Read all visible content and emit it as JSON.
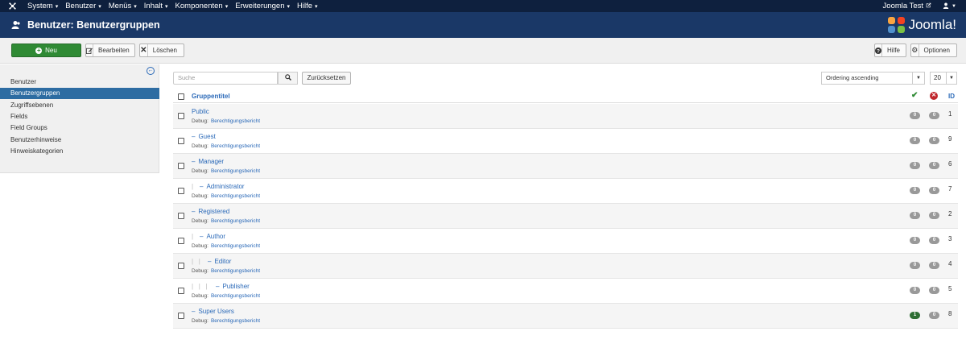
{
  "topbar": {
    "menu": [
      {
        "label": "System"
      },
      {
        "label": "Benutzer"
      },
      {
        "label": "Menüs"
      },
      {
        "label": "Inhalt"
      },
      {
        "label": "Komponenten"
      },
      {
        "label": "Erweiterungen"
      },
      {
        "label": "Hilfe"
      }
    ],
    "site_name": "Joomla Test",
    "external_icon": "external-link-icon",
    "user_icon": "user-icon"
  },
  "header": {
    "title": "Benutzer: Benutzergruppen",
    "brand": "Joomla!",
    "icon": "users-icon"
  },
  "toolbar": {
    "new_label": "Neu",
    "edit_label": "Bearbeiten",
    "delete_label": "Löschen",
    "help_label": "Hilfe",
    "options_label": "Optionen"
  },
  "sidebar": {
    "items": [
      {
        "label": "Benutzer"
      },
      {
        "label": "Benutzergruppen"
      },
      {
        "label": "Zugriffsebenen"
      },
      {
        "label": "Fields"
      },
      {
        "label": "Field Groups"
      },
      {
        "label": "Benutzerhinweise"
      },
      {
        "label": "Hinweiskategorien"
      }
    ],
    "active_index": 1
  },
  "filters": {
    "search_placeholder": "Suche",
    "reset_label": "Zurücksetzen",
    "ordering_value": "Ordering ascending",
    "limit_value": "20"
  },
  "table": {
    "column_title": "Gruppentitel",
    "column_id": "ID",
    "debug_prefix": "Debug:",
    "debug_link": "Berechtigungsbericht",
    "rows": [
      {
        "name": "Public",
        "prefix": "",
        "level": 0,
        "active": "0",
        "blocked": "0",
        "id": "1"
      },
      {
        "name": "Guest",
        "prefix": "–",
        "level": 0,
        "active": "0",
        "blocked": "0",
        "id": "9"
      },
      {
        "name": "Manager",
        "prefix": "–",
        "level": 0,
        "active": "0",
        "blocked": "0",
        "id": "6"
      },
      {
        "name": "Administrator",
        "prefix": "–",
        "level": 1,
        "active": "0",
        "blocked": "0",
        "id": "7"
      },
      {
        "name": "Registered",
        "prefix": "–",
        "level": 0,
        "active": "0",
        "blocked": "0",
        "id": "2"
      },
      {
        "name": "Author",
        "prefix": "–",
        "level": 1,
        "active": "0",
        "blocked": "0",
        "id": "3"
      },
      {
        "name": "Editor",
        "prefix": "–",
        "level": 2,
        "active": "0",
        "blocked": "0",
        "id": "4"
      },
      {
        "name": "Publisher",
        "prefix": "–",
        "level": 3,
        "active": "0",
        "blocked": "0",
        "id": "5"
      },
      {
        "name": "Super Users",
        "prefix": "–",
        "level": 0,
        "active": "1",
        "blocked": "0",
        "id": "8"
      }
    ]
  },
  "colors": {
    "topbar_bg": "#0e203e",
    "header_bg": "#1a3867",
    "new_button": "#2f8a34",
    "sidebar_active": "#2d6ca2",
    "link": "#2a69b8"
  }
}
